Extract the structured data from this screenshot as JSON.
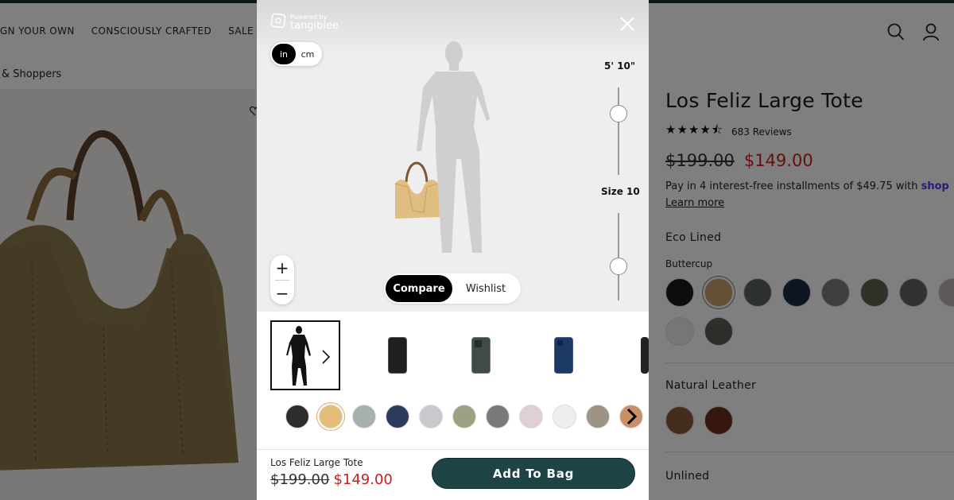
{
  "nav": {
    "items": [
      "IGN YOUR OWN",
      "CONSCIOUSLY CRAFTED",
      "SALE"
    ]
  },
  "breadcrumb": "& Shoppers",
  "product": {
    "title": "Los Feliz Large Tote",
    "rating_stars": "★★★★⯪",
    "rating": 4.5,
    "reviews": "683 Reviews",
    "price_old": "$199.00",
    "price_new": "$149.00",
    "installments": "Pay in 4 interest-free installments of $49.75 with ",
    "installments_brand": "shop",
    "learn_more": "Learn more",
    "eco_lined_label": "Eco Lined",
    "selected_color": "Buttercup",
    "eco_colors": [
      "#1b1b1b",
      "#c9a06a",
      "#5d6362",
      "#1d2a46",
      "#7a7c7c",
      "#5f6550",
      "#626463",
      "#b9b3b0",
      "#ececec",
      "#5b5c52"
    ],
    "natural_leather_label": "Natural Leather",
    "leather_colors": [
      "#8a5b3c",
      "#6b2f1e"
    ],
    "unlined_label": "Unlined"
  },
  "modal": {
    "powered_by": "Powered by",
    "brand": "tangiblee",
    "units": [
      "in",
      "cm"
    ],
    "active_unit": "in",
    "height_label": "5' 10\"",
    "size_label": "Size 10",
    "zoom_in": "+",
    "zoom_out": "−",
    "compare_label": "Compare",
    "wishlist_label": "Wishlist",
    "thumbnails": [
      "person",
      "phone-black",
      "phone-green",
      "phone-blue",
      "phone-partial"
    ],
    "colors": [
      "#2d2d2d",
      "#e3bd78",
      "#a7b1ac",
      "#2e3b5c",
      "#c8c9cc",
      "#9aa283",
      "#7a7a7a",
      "#e0cfd7",
      "#eeeeee",
      "#9c9485",
      "#c99067"
    ],
    "footer_name": "Los Feliz Large Tote",
    "footer_price_old": "$199.00",
    "footer_price_new": "$149.00",
    "add_to_bag": "Add To Bag"
  }
}
